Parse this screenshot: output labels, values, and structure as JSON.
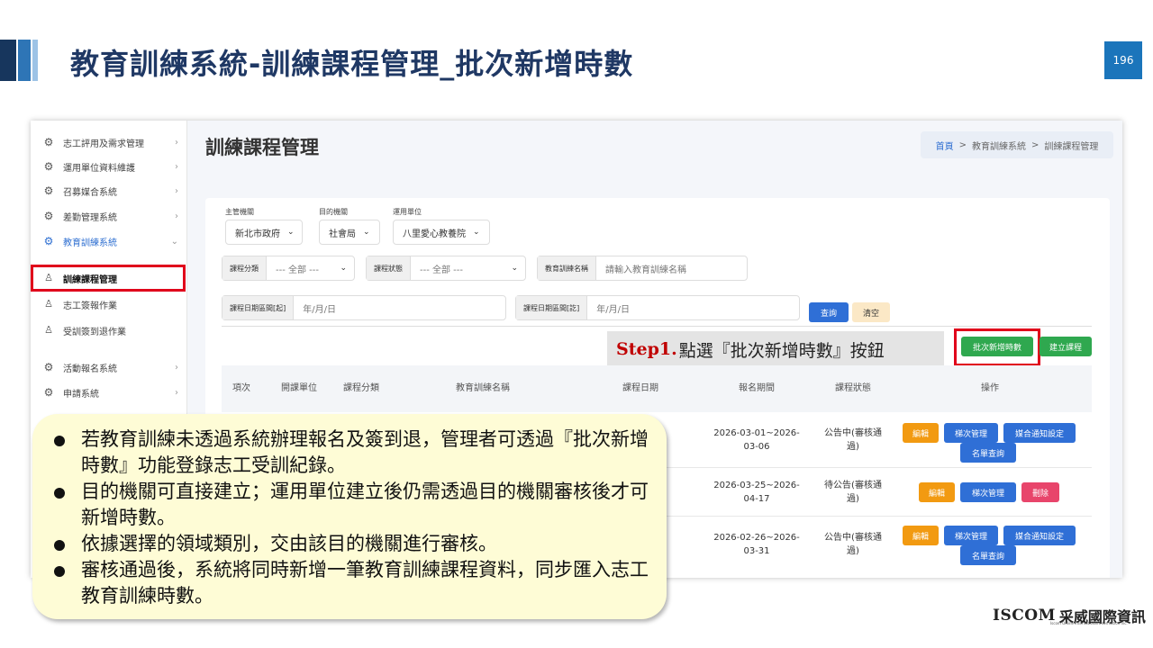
{
  "slide": {
    "title": "教育訓練系統-訓練課程管理_批次新增時數",
    "page_number": "196"
  },
  "sidebar": {
    "items": [
      {
        "label": "志工評用及需求管理",
        "icon": "gear-icon"
      },
      {
        "label": "運用單位資料維護",
        "icon": "gear-icon"
      },
      {
        "label": "召募媒合系統",
        "icon": "gear-icon"
      },
      {
        "label": "差勤管理系統",
        "icon": "gear-icon"
      },
      {
        "label": "教育訓練系統",
        "icon": "gear-icon"
      },
      {
        "label": "訓練課程管理",
        "icon": "user-icon"
      },
      {
        "label": "志工簽報作業",
        "icon": "user-icon"
      },
      {
        "label": "受訓簽到退作業",
        "icon": "user-icon"
      },
      {
        "label": "活動報名系統",
        "icon": "gear-icon"
      },
      {
        "label": "申請系統",
        "icon": "gear-icon"
      }
    ]
  },
  "page": {
    "heading": "訓練課程管理",
    "breadcrumb": [
      "首頁",
      "教育訓練系統",
      "訓練課程管理"
    ],
    "breadcrumb_sep": ">"
  },
  "filters": {
    "org_label": "主管機關",
    "org_value": "新北市政府",
    "purpose_label": "目的機關",
    "purpose_value": "社會局",
    "unit_label": "運用單位",
    "unit_value": "八里愛心教養院",
    "category_label": "課程分類",
    "category_value": "--- 全部 ---",
    "status_label": "課程狀態",
    "status_value": "--- 全部 ---",
    "name_label": "教育訓練名稱",
    "name_placeholder": "請輸入教育訓練名稱",
    "course_date_label": "課程日期區間[起]",
    "course_date_placeholder": "年/月/日",
    "signup_date_label": "課程日期區間[訖]",
    "signup_date_placeholder": "年/月/日",
    "query_button": "查詢",
    "clear_button": "清空"
  },
  "actions": {
    "batch_button": "批次新增時數",
    "create_button": "建立課程"
  },
  "step": {
    "prefix": "Step1.",
    "text": "點選『批次新增時數』按鈕"
  },
  "table": {
    "headers": [
      "項次",
      "開課單位",
      "課程分類",
      "教育訓練名稱",
      "課程日期",
      "報名期間",
      "課程狀態",
      "操作"
    ],
    "rows": [
      {
        "signup": "2026-03-01~2026-03-06",
        "status": "公告中(審核通過)",
        "ops": [
          "編輯",
          "梯次管理",
          "媒合通知設定",
          "名單查詢"
        ]
      },
      {
        "signup": "2026-03-25~2026-04-17",
        "status": "待公告(審核通過)",
        "ops": [
          "編輯",
          "梯次管理",
          "刪除"
        ]
      },
      {
        "signup": "2026-02-26~2026-03-31",
        "status": "公告中(審核通過)",
        "ops": [
          "編輯",
          "梯次管理",
          "媒合通知設定",
          "名單查詢"
        ]
      }
    ]
  },
  "callout": {
    "bullets": [
      "若教育訓練未透過系統辦理報名及簽到退，管理者可透過『批次新增時數』功能登錄志工受訓紀錄。",
      "目的機關可直接建立；運用單位建立後仍需透過目的機關審核後才可新增時數。",
      "依據選擇的領域類別，交由該目的機關進行審核。",
      "審核通過後，系統將同時新增一筆教育訓練課程資料，同步匯入志工教育訓練時數。"
    ]
  },
  "logo": {
    "en": "ISCOM",
    "zh": "采威國際資訊",
    "tagline": "Iscom Online International Information Inc."
  }
}
